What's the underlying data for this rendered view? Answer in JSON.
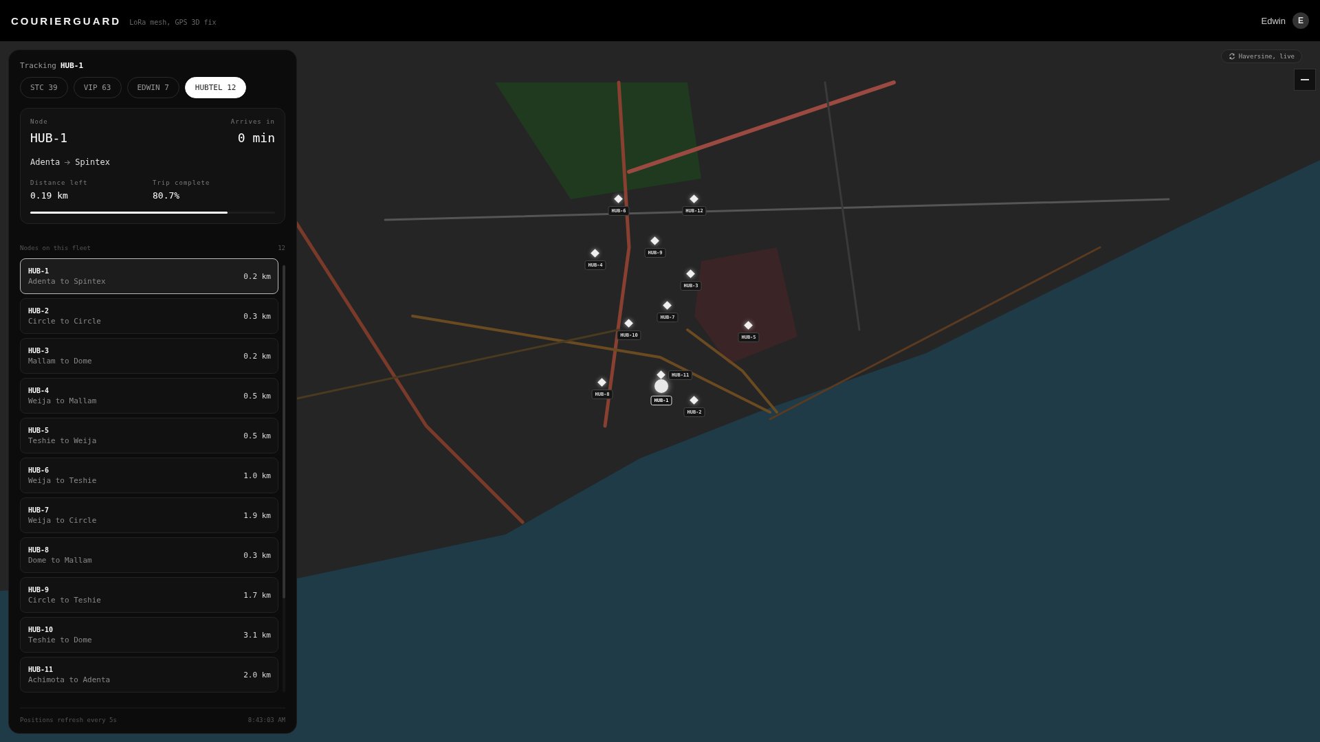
{
  "header": {
    "brand": "COURIERGUARD",
    "subtitle": "LoRa mesh, GPS 3D fix",
    "user": "Edwin",
    "avatar": "E"
  },
  "map_controls": {
    "mode": "Haversine, live"
  },
  "panel": {
    "tracking_label": "Tracking",
    "tracking_node": "HUB-1",
    "fleets": [
      {
        "label": "STC 39",
        "selected": false
      },
      {
        "label": "VIP 63",
        "selected": false
      },
      {
        "label": "EDWIN 7",
        "selected": false
      },
      {
        "label": "HUBTEL 12",
        "selected": true
      }
    ],
    "summary": {
      "node_label": "Node",
      "node": "HUB-1",
      "eta_label": "Arrives in",
      "eta": "0 min",
      "from": "Adenta",
      "to": "Spintex",
      "distance_label": "Distance left",
      "distance": "0.19 km",
      "progress_label": "Trip complete",
      "progress": "80.7%",
      "level": 0.807
    },
    "list_title": "Nodes on this fleet",
    "list_count": "12",
    "nodes": [
      {
        "name": "HUB-1",
        "route": "Adenta to Spintex",
        "distance": "0.2 km",
        "selected": true
      },
      {
        "name": "HUB-2",
        "route": "Circle to Circle",
        "distance": "0.3 km",
        "selected": false
      },
      {
        "name": "HUB-3",
        "route": "Mallam to Dome",
        "distance": "0.2 km",
        "selected": false
      },
      {
        "name": "HUB-4",
        "route": "Weija to Mallam",
        "distance": "0.5 km",
        "selected": false
      },
      {
        "name": "HUB-5",
        "route": "Teshie to Weija",
        "distance": "0.5 km",
        "selected": false
      },
      {
        "name": "HUB-6",
        "route": "Weija to Teshie",
        "distance": "1.0 km",
        "selected": false
      },
      {
        "name": "HUB-7",
        "route": "Weija to Circle",
        "distance": "1.9 km",
        "selected": false
      },
      {
        "name": "HUB-8",
        "route": "Dome to Mallam",
        "distance": "0.3 km",
        "selected": false
      },
      {
        "name": "HUB-9",
        "route": "Circle to Teshie",
        "distance": "1.7 km",
        "selected": false
      },
      {
        "name": "HUB-10",
        "route": "Teshie to Dome",
        "distance": "3.1 km",
        "selected": false
      },
      {
        "name": "HUB-11",
        "route": "Achimota to Adenta",
        "distance": "2.0 km",
        "selected": false
      }
    ],
    "footer_note": "Positions refresh every 5s",
    "footer_time": "8:43:03 AM"
  },
  "markers": [
    {
      "label": "HUB-6",
      "selected": false
    },
    {
      "label": "HUB-12",
      "selected": false
    },
    {
      "label": "HUB-9",
      "selected": false
    },
    {
      "label": "HUB-4",
      "selected": false
    },
    {
      "label": "HUB-3",
      "selected": false
    },
    {
      "label": "HUB-7",
      "selected": false
    },
    {
      "label": "HUB-10",
      "selected": false
    },
    {
      "label": "HUB-5",
      "selected": false
    },
    {
      "label": "HUB-11",
      "selected": false
    },
    {
      "label": "HUB-8",
      "selected": false
    },
    {
      "label": "HUB-1",
      "selected": true
    },
    {
      "label": "HUB-2",
      "selected": false
    }
  ]
}
